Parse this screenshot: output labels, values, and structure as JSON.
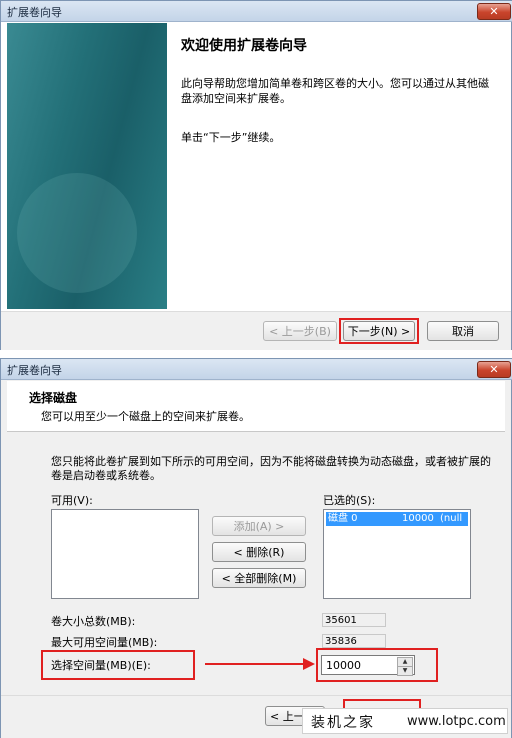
{
  "dialog1": {
    "title": "扩展卷向导",
    "close_glyph": "✕",
    "heading": "欢迎使用扩展卷向导",
    "description": "此向导帮助您增加简单卷和跨区卷的大小。您可以通过从其他磁盘添加空间来扩展卷。",
    "hint": "单击“下一步”继续。",
    "buttons": {
      "back": "< 上一步(B)",
      "next": "下一步(N) >",
      "cancel": "取消"
    }
  },
  "dialog2": {
    "title": "扩展卷向导",
    "close_glyph": "✕",
    "header_title": "选择磁盘",
    "header_subtitle": "您可以用至少一个磁盘上的空间来扩展卷。",
    "info": "您只能将此卷扩展到如下所示的可用空间，因为不能将磁盘转换为动态磁盘，或者被扩展的卷是启动卷或系统卷。",
    "available_label": "可用(V):",
    "selected_label": "已选的(S):",
    "selected_items": [
      {
        "disk": "磁盘 0",
        "size": "10000",
        "extra": "(null"
      }
    ],
    "buttons": {
      "add": "添加(A) >",
      "remove": "< 删除(R)",
      "remove_all": "< 全部删除(M)",
      "back_partial": "< 上一"
    },
    "fields": {
      "total_label": "卷大小总数(MB):",
      "total_value": "35601",
      "max_label": "最大可用空间量(MB):",
      "max_value": "35836",
      "select_label": "选择空间量(MB)(E):",
      "select_value": "10000"
    }
  },
  "watermark": {
    "cn": "装机之家",
    "url": "www.lotpc.com"
  },
  "colors": {
    "annotation_red": "#e02020",
    "selection_blue": "#3399ff",
    "side_panel_teal": "#237078"
  }
}
